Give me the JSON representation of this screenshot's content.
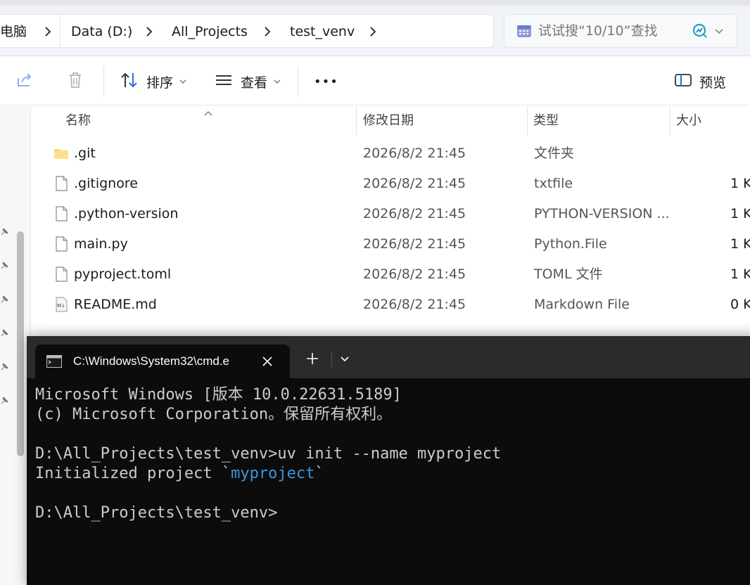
{
  "explorer": {
    "breadcrumb": [
      "电脑",
      "Data (D:)",
      "All_Projects",
      "test_venv"
    ],
    "search": {
      "placeholder": "试试搜“10/10”查找"
    },
    "toolbar": {
      "sort_label": "排序",
      "view_label": "查看",
      "more_label": "•••",
      "preview_label": "预览"
    },
    "columns": {
      "name": "名称",
      "modified": "修改日期",
      "type": "类型",
      "size": "大小"
    },
    "files": [
      {
        "name": ".git",
        "modified": "2026/8/2 21:45",
        "type": "文件夹",
        "size": "",
        "icon": "folder-icon"
      },
      {
        "name": ".gitignore",
        "modified": "2026/8/2 21:45",
        "type": "txtfile",
        "size": "1 K",
        "icon": "file-icon"
      },
      {
        "name": ".python-version",
        "modified": "2026/8/2 21:45",
        "type": "PYTHON-VERSION ...",
        "size": "1 K",
        "icon": "file-icon"
      },
      {
        "name": "main.py",
        "modified": "2026/8/2 21:45",
        "type": "Python.File",
        "size": "1 K",
        "icon": "file-icon"
      },
      {
        "name": "pyproject.toml",
        "modified": "2026/8/2 21:45",
        "type": "TOML 文件",
        "size": "1 K",
        "icon": "file-icon"
      },
      {
        "name": "README.md",
        "modified": "2026/8/2 21:45",
        "type": "Markdown File",
        "size": "0 K",
        "icon": "markdown-file-icon"
      }
    ]
  },
  "terminal": {
    "tab_title": "C:\\Windows\\System32\\cmd.e",
    "lines": {
      "l1": "Microsoft Windows [版本 10.0.22631.5189]",
      "l2": "(c) Microsoft Corporation。保留所有权利。",
      "l3": "",
      "l4": "D:\\All_Projects\\test_venv>uv init --name myproject",
      "l5_prefix": "Initialized project `",
      "l5_highlight": "myproject",
      "l5_suffix": "`",
      "l6": "",
      "l7": "D:\\All_Projects\\test_venv>"
    },
    "colors": {
      "background": "#0c0c0c",
      "text": "#cccccc",
      "highlight": "#3a96dd"
    }
  }
}
